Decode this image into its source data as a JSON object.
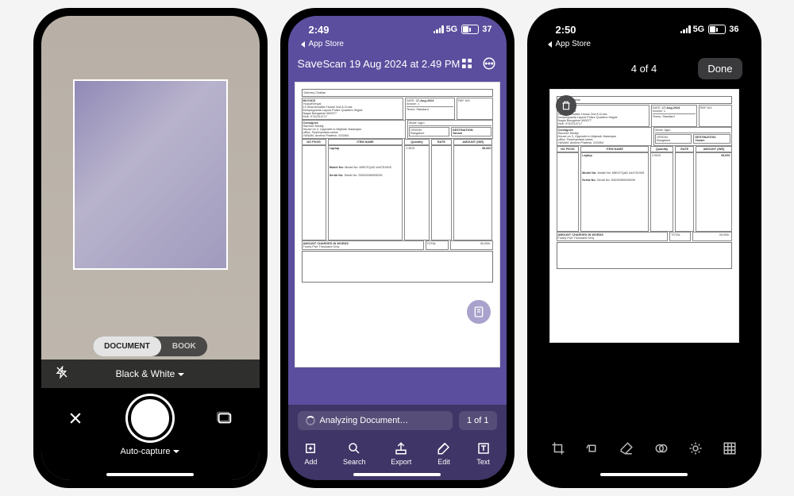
{
  "phone1": {
    "mode_document": "DOCUMENT",
    "mode_book": "BOOK",
    "filter": "Black & White",
    "autocapture": "Auto-capture"
  },
  "phone2": {
    "time": "2:49",
    "network": "5G",
    "battery_pct": "37",
    "breadcrumb": "App Store",
    "save": "Save",
    "title": "Scan 19 Aug 2024 at 2.49 PM",
    "analyzing": "Analyzing Document…",
    "count": "1 of 1",
    "tools": {
      "add": "Add",
      "search": "Search",
      "export": "Export",
      "edit": "Edit",
      "text": "Text"
    }
  },
  "phone3": {
    "time": "2:50",
    "network": "5G",
    "battery_pct": "36",
    "breadcrumb": "App Store",
    "counter": "4 of 4",
    "done": "Done"
  },
  "document": {
    "title": "Delivery Challan",
    "invoice_label": "INVOICE",
    "shipper_name": "Yousuf/Vinyal",
    "addr1": "13 Shamshuddin House 2nd A Cross",
    "addr2": "Kempegowda Layout Police Quarters Hegde",
    "addr3": "Nagar Bangalore 560077",
    "mob": "Mob: 9742214717",
    "consignee_label": "Consignee",
    "consignee_name": "Ramesh Reddy",
    "c_addr1": "House no 3, Opposite to Majestic Natarajan",
    "c_addr2": "office, Pashhandala street,",
    "c_addr3": "YANAM, Andhra Pradesh, 533464",
    "date_label": "DATE:",
    "date": "17-Aug-2024",
    "invoice_no": "Invoice: 1",
    "terms": "Terms: Standard",
    "mode": "Mode: Agro",
    "ref": "REF NO:",
    "origin": "ORIGIN:",
    "origin_v": "Bangalore",
    "dest": "DESTINATION:",
    "dest_v": "Yanam",
    "col_pkgs": "NO PKGS",
    "col_item": "ITEM NAME",
    "col_qty": "Quantity",
    "col_rate": "RATE",
    "col_amt": "AMOUNT (INR)",
    "item_name": "Laptop",
    "qty": "2 BOX",
    "amount": "45,000",
    "model": "Model No: 65ECFQAD #4475190S",
    "serial": "Serial No: S00S9289005030",
    "words_label": "AMOUNT CHARGED IN WORDS",
    "words": "Fourty Five Thousand Only",
    "total_label": "TOTAL",
    "total": "45,000/-"
  }
}
